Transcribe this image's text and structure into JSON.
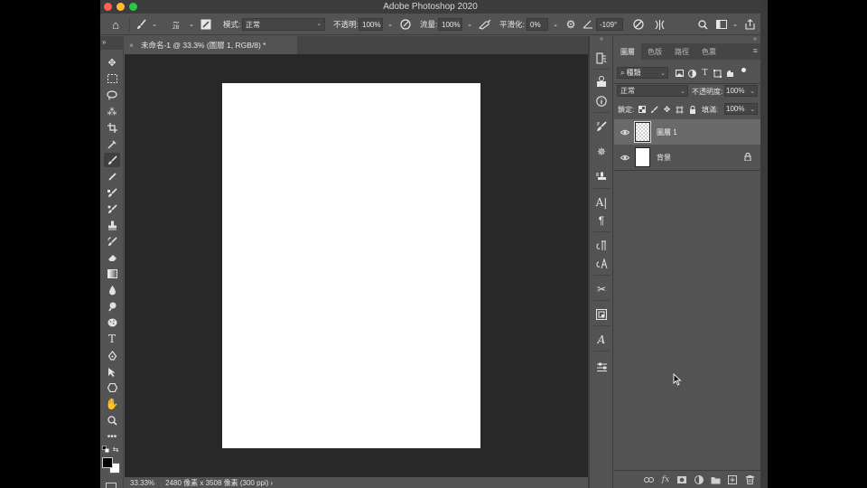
{
  "window": {
    "title": "Adobe Photoshop 2020"
  },
  "options_bar": {
    "home_icon": "home-icon",
    "brush_size": "28",
    "mode_label": "模式:",
    "mode_value": "正常",
    "opacity_label": "不透明:",
    "opacity_value": "100%",
    "flow_label": "流量:",
    "flow_value": "100%",
    "smoothing_label": "平滑化:",
    "smoothing_value": "0%",
    "angle_value": "-109°"
  },
  "document": {
    "tab_title": "未命名-1 @ 33.3% (圖層 1, RGB/8) *",
    "zoom": "33.33%",
    "info": "2480 像素 x 3508 像素 (300 ppi)"
  },
  "layers_panel": {
    "tabs": [
      {
        "label": "圖層",
        "active": true
      },
      {
        "label": "色版",
        "active": false
      },
      {
        "label": "路徑",
        "active": false
      },
      {
        "label": "色票",
        "active": false
      }
    ],
    "filter_value": "種類",
    "blend_mode": "正常",
    "opacity_label": "不透明度:",
    "opacity_value": "100%",
    "lock_label": "鎖定:",
    "fill_label": "填滿:",
    "fill_value": "100%",
    "layers": [
      {
        "name": "圖層 1",
        "selected": true,
        "visible": true,
        "locked": false
      },
      {
        "name": "背景",
        "selected": false,
        "visible": true,
        "locked": true
      }
    ]
  },
  "colors": {
    "app_bg": "#535353",
    "canvas_bg": "#282828",
    "paper": "#ffffff",
    "selected_layer": "#6a6a6a"
  }
}
